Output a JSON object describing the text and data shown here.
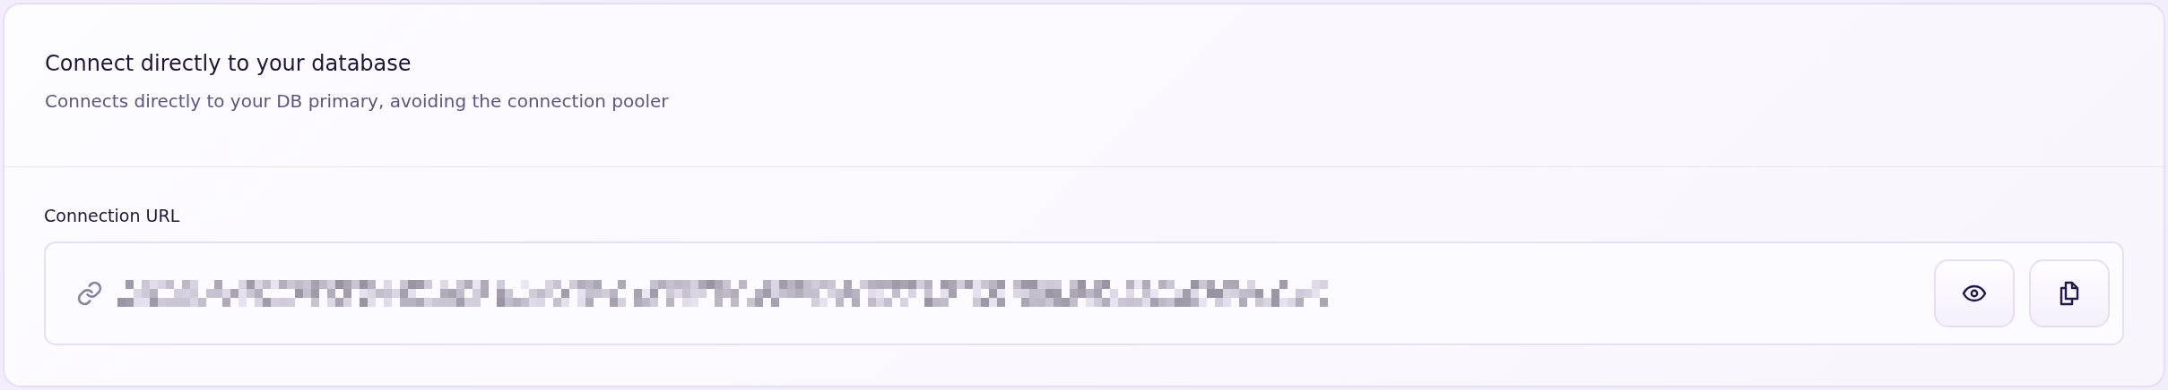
{
  "card": {
    "title": "Connect directly to your database",
    "subtitle": "Connects directly to your DB primary, avoiding the connection pooler",
    "field": {
      "label": "Connection URL"
    }
  }
}
